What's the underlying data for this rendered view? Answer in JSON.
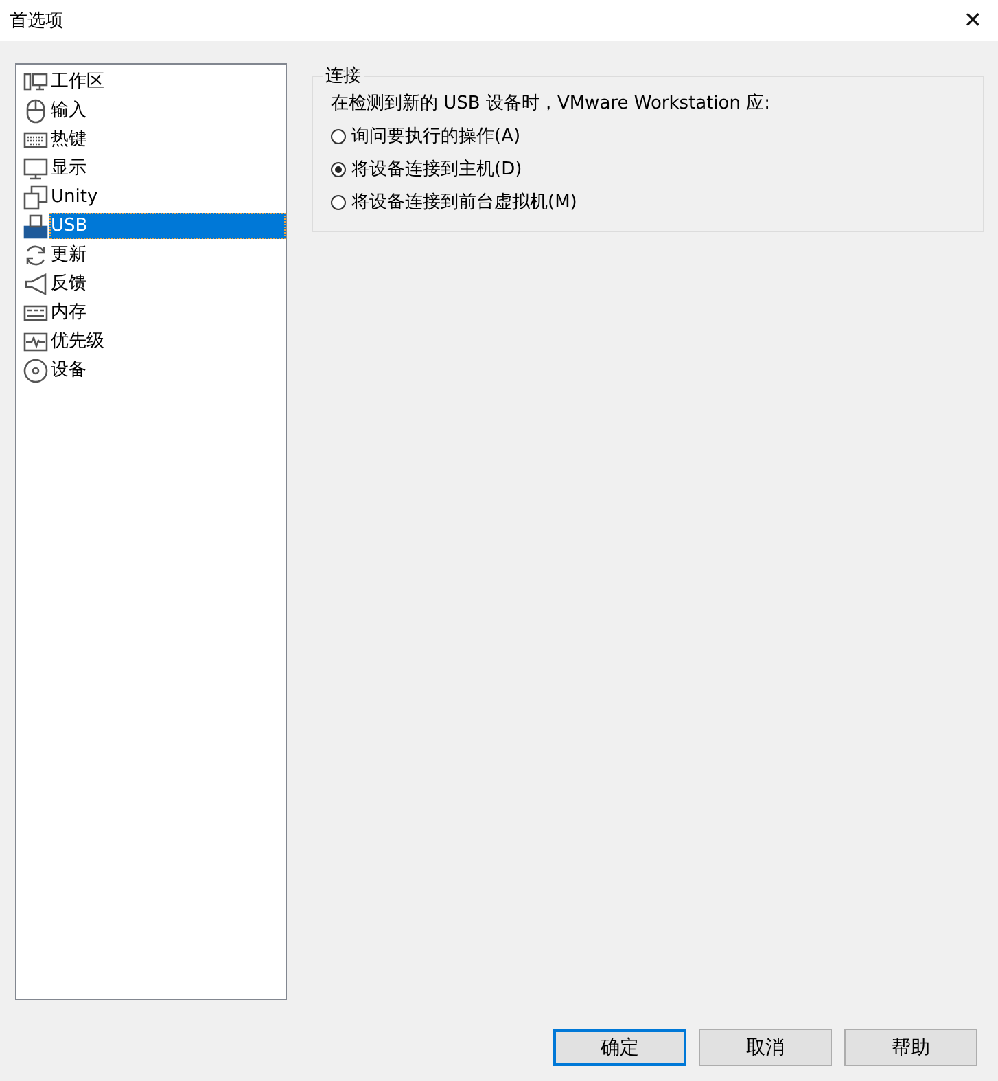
{
  "window": {
    "title": "首选项",
    "close": "✕"
  },
  "sidebar": {
    "items": [
      {
        "label": "工作区",
        "selected": false
      },
      {
        "label": "输入",
        "selected": false
      },
      {
        "label": "热键",
        "selected": false
      },
      {
        "label": "显示",
        "selected": false
      },
      {
        "label": "Unity",
        "selected": false
      },
      {
        "label": "USB",
        "selected": true
      },
      {
        "label": "更新",
        "selected": false
      },
      {
        "label": "反馈",
        "selected": false
      },
      {
        "label": "内存",
        "selected": false
      },
      {
        "label": "优先级",
        "selected": false
      },
      {
        "label": "设备",
        "selected": false
      }
    ]
  },
  "group": {
    "title": "连接",
    "prompt": "在检测到新的 USB 设备时，VMware Workstation 应:",
    "options": [
      {
        "label": "询问要执行的操作(A)",
        "selected": false
      },
      {
        "label": "将设备连接到主机(D)",
        "selected": true
      },
      {
        "label": "将设备连接到前台虚拟机(M)",
        "selected": false
      }
    ]
  },
  "buttons": [
    {
      "label": "确定",
      "default": true
    },
    {
      "label": "取消",
      "default": false
    },
    {
      "label": "帮助",
      "default": false
    }
  ]
}
